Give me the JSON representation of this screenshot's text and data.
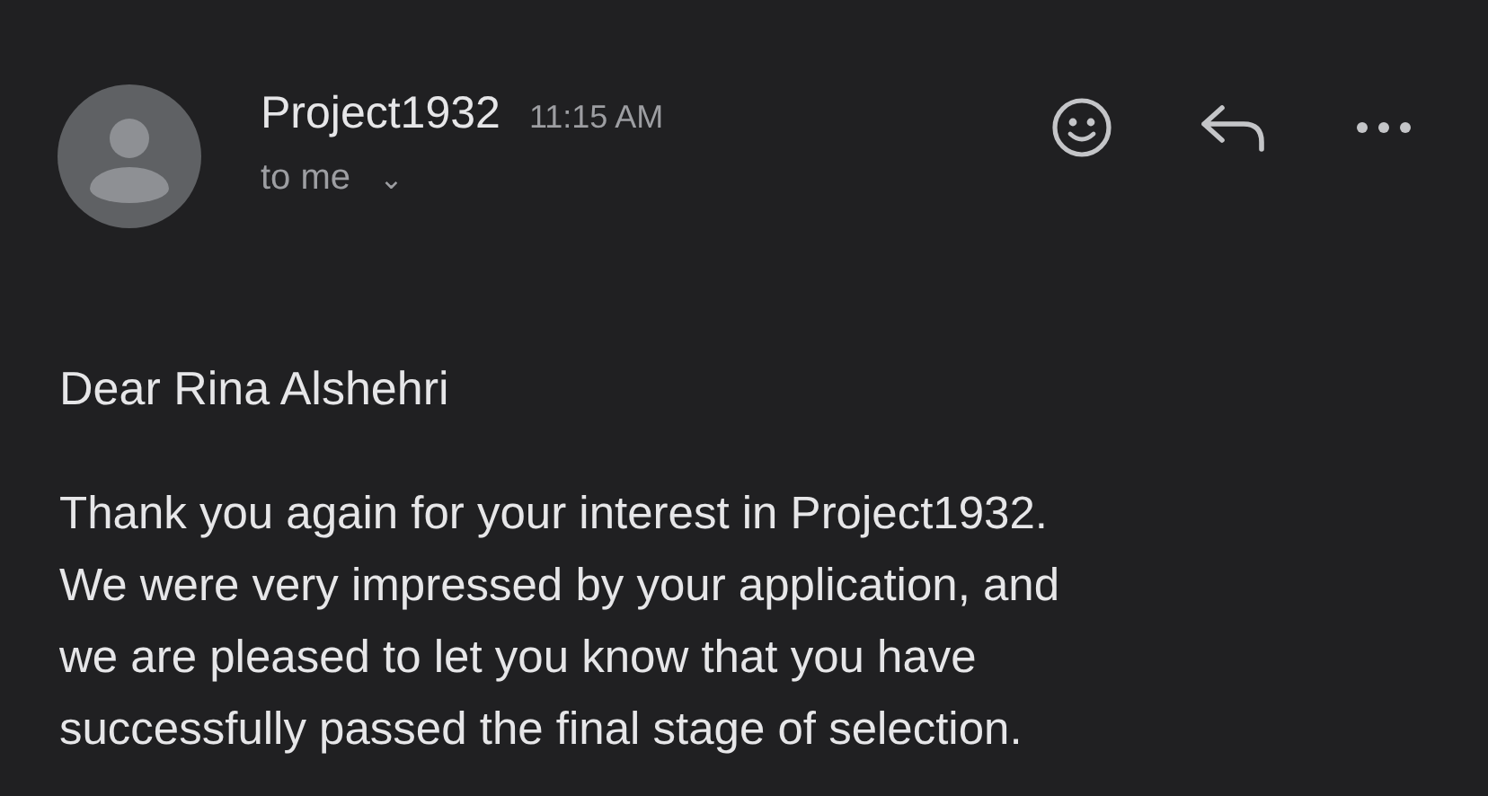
{
  "message": {
    "sender": "Project1932",
    "time": "11:15 AM",
    "recipient": "to me",
    "recipient_expander": "⌄",
    "greeting": "Dear Rina Alshehri",
    "body_lines": [
      "Thank you again for your interest in Project1932.",
      "We were very impressed by your application, and",
      "we are pleased to let you know that you have",
      "successfully passed the final stage of selection."
    ]
  }
}
